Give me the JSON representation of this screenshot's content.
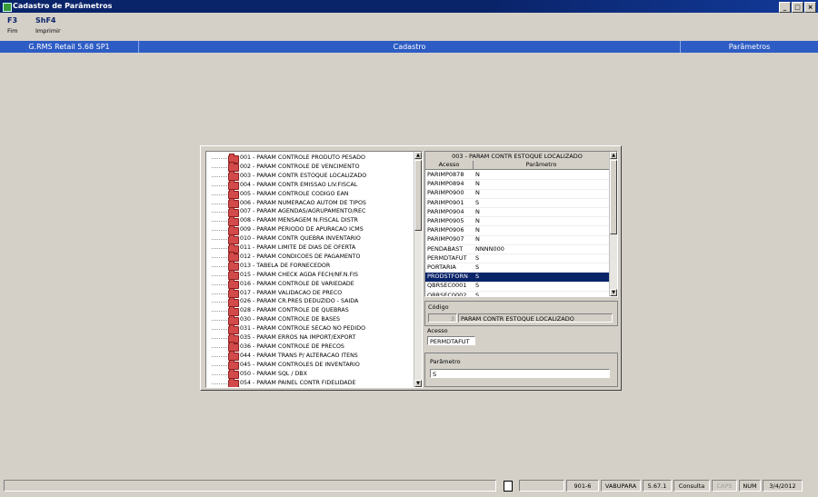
{
  "window": {
    "title": "Cadastro de Parâmetros"
  },
  "menu": [
    {
      "key": "F3",
      "label": "Fim"
    },
    {
      "key": "ShF4",
      "label": "Imprimir"
    }
  ],
  "header": {
    "app": "G.RMS Retail 5.68 SP1",
    "module": "Cadastro",
    "section": "Parâmetros"
  },
  "tree": {
    "items": [
      "001 - PARAM CONTROLE PRODUTO PESADO",
      "002 - PARAM CONTROLE DE VENCIMENTO",
      "003 - PARAM CONTR ESTOQUE LOCALIZADO",
      "004 - PARAM CONTR EMISSAO LIV.FISCAL",
      "005 - PARAM CONTROLE CODIGO EAN",
      "006 - PARAM NUMERACAO AUTOM DE TIPOS",
      "007 - PARAM AGENDAS/AGRUPAMENTO/REC",
      "008 - PARAM MENSAGEM N.FISCAL DISTR",
      "009 - PARAM PERIODO DE APURACAO ICMS",
      "010 - PARAM CONTR QUEBRA INVENTARIO",
      "011 - PARAM LIMITE DE DIAS DE OFERTA",
      "012 - PARAM CONDICOES DE PAGAMENTO",
      "013 - TABELA DE FORNECEDOR",
      "015 - PARAM CHECK AGDA FECH/NF.N.FIS",
      "016 - PARAM CONTROLE DE VARIEDADE",
      "017 - PARAM VALIDACAO DE PRECO",
      "026 - PARAM CR.PRES DEDUZIDO - SAIDA",
      "028 - PARAM CONTROLE DE QUEBRAS",
      "030 - PARAM CONTROLE DE BASES",
      "031 - PARAM CONTROLE SECAO NO PEDIDO",
      "035 - PARAM ERROS NA IMPORT/EXPORT",
      "036 - PARAM CONTROLE DE PRECOS",
      "044 - PARAM TRANS P/ ALTERACAO ITENS",
      "045 - PARAM CONTROLES DE INVENTARIO",
      "050 - PARAM SQL / DBX",
      "054 - PARAM PAINEL CONTR FIDELIDADE"
    ]
  },
  "grid": {
    "title": "003 - PARAM CONTR ESTOQUE LOCALIZADO",
    "columns": [
      "Acesso",
      "Parâmetro"
    ],
    "selected_index": 11,
    "rows": [
      [
        "PARIMP0878",
        "N"
      ],
      [
        "PARIMP0894",
        "N"
      ],
      [
        "PARIMP0900",
        "N"
      ],
      [
        "PARIMP0901",
        "S"
      ],
      [
        "PARIMP0904",
        "N"
      ],
      [
        "PARIMP0905",
        "N"
      ],
      [
        "PARIMP0906",
        "N"
      ],
      [
        "PARIMP0907",
        "N"
      ],
      [
        "PENDABAST",
        "NNNN000"
      ],
      [
        "PERMDTAFUT",
        "S"
      ],
      [
        "PORTARIA",
        "S"
      ],
      [
        "PRODSTFORN",
        "S"
      ],
      [
        "QBRSEC0001",
        "S"
      ],
      [
        "QBRSEC0002",
        "S"
      ]
    ]
  },
  "form": {
    "codigo_label": "Código",
    "codigo_num": "3",
    "codigo_desc": "PARAM CONTR ESTOQUE LOCALIZADO",
    "acesso_label": "Acesso",
    "acesso_value": "PERMDTAFUT",
    "parametro_label": "Parâmetro",
    "parametro_value": "S"
  },
  "status": {
    "code": "901-6",
    "user": "VABUPARA",
    "version": "5.67.1",
    "mode": "Consulta",
    "caps": "CAPS",
    "num": "NUM",
    "date": "3/4/2012"
  }
}
